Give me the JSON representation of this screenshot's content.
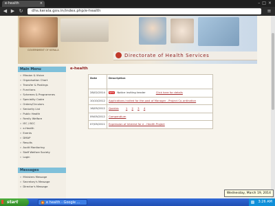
{
  "browser": {
    "tab_title": "e-health",
    "tab_close": "×",
    "window_controls": "–□×",
    "back": "◀",
    "forward": "▶",
    "reload": "↻",
    "url": "dhs.kerala.gov.in/index.php/e-health",
    "menu": "≡"
  },
  "site": {
    "org_title": "Directorate of Health Services",
    "ministry_text": "GOVERNMENT OF KERALA"
  },
  "sidebar": {
    "main_menu_title": "Main Menu",
    "items": [
      "Mission & Vision",
      "Organisation Chart",
      "Transfer & Postings",
      "Functions",
      "Schemes & Programmes",
      "Speciality Cadre",
      "Orders/Circulars",
      "Seniority List",
      "Public Health",
      "Family Welfare",
      "IEC / BCC",
      "e-Health",
      "Events",
      "DMAP",
      "Results",
      "Audit Monitoring",
      "Staff Welfare Society",
      "Login"
    ],
    "messages_title": "Messages",
    "message_items": [
      "Ministers Message",
      "Secretary's Message",
      "Director's Message"
    ]
  },
  "main": {
    "breadcrumb": "e-health",
    "table": {
      "headers": [
        "Date",
        "Description"
      ],
      "rows": [
        {
          "date": "28/02/2014",
          "badge": "NEW",
          "text": "Notice inviting tender",
          "link": "Click here for details"
        },
        {
          "date": "10/10/2012",
          "link": "Applications invited for the post of Manager - Project Co-ordination"
        },
        {
          "date": "16/05/2012",
          "link": "Queries",
          "pages": [
            "1",
            "2",
            "3",
            "4"
          ]
        },
        {
          "date": "09/05/2012",
          "link": "Compendium"
        },
        {
          "date": "07/05/2011",
          "link": "Expression of Interest for e - Health Project"
        }
      ]
    }
  },
  "taskbar": {
    "start_label": "start",
    "task_label": "e health - Google ...",
    "clock": "3:26 AM",
    "tooltip": "Wednesday, March 19, 2014"
  }
}
